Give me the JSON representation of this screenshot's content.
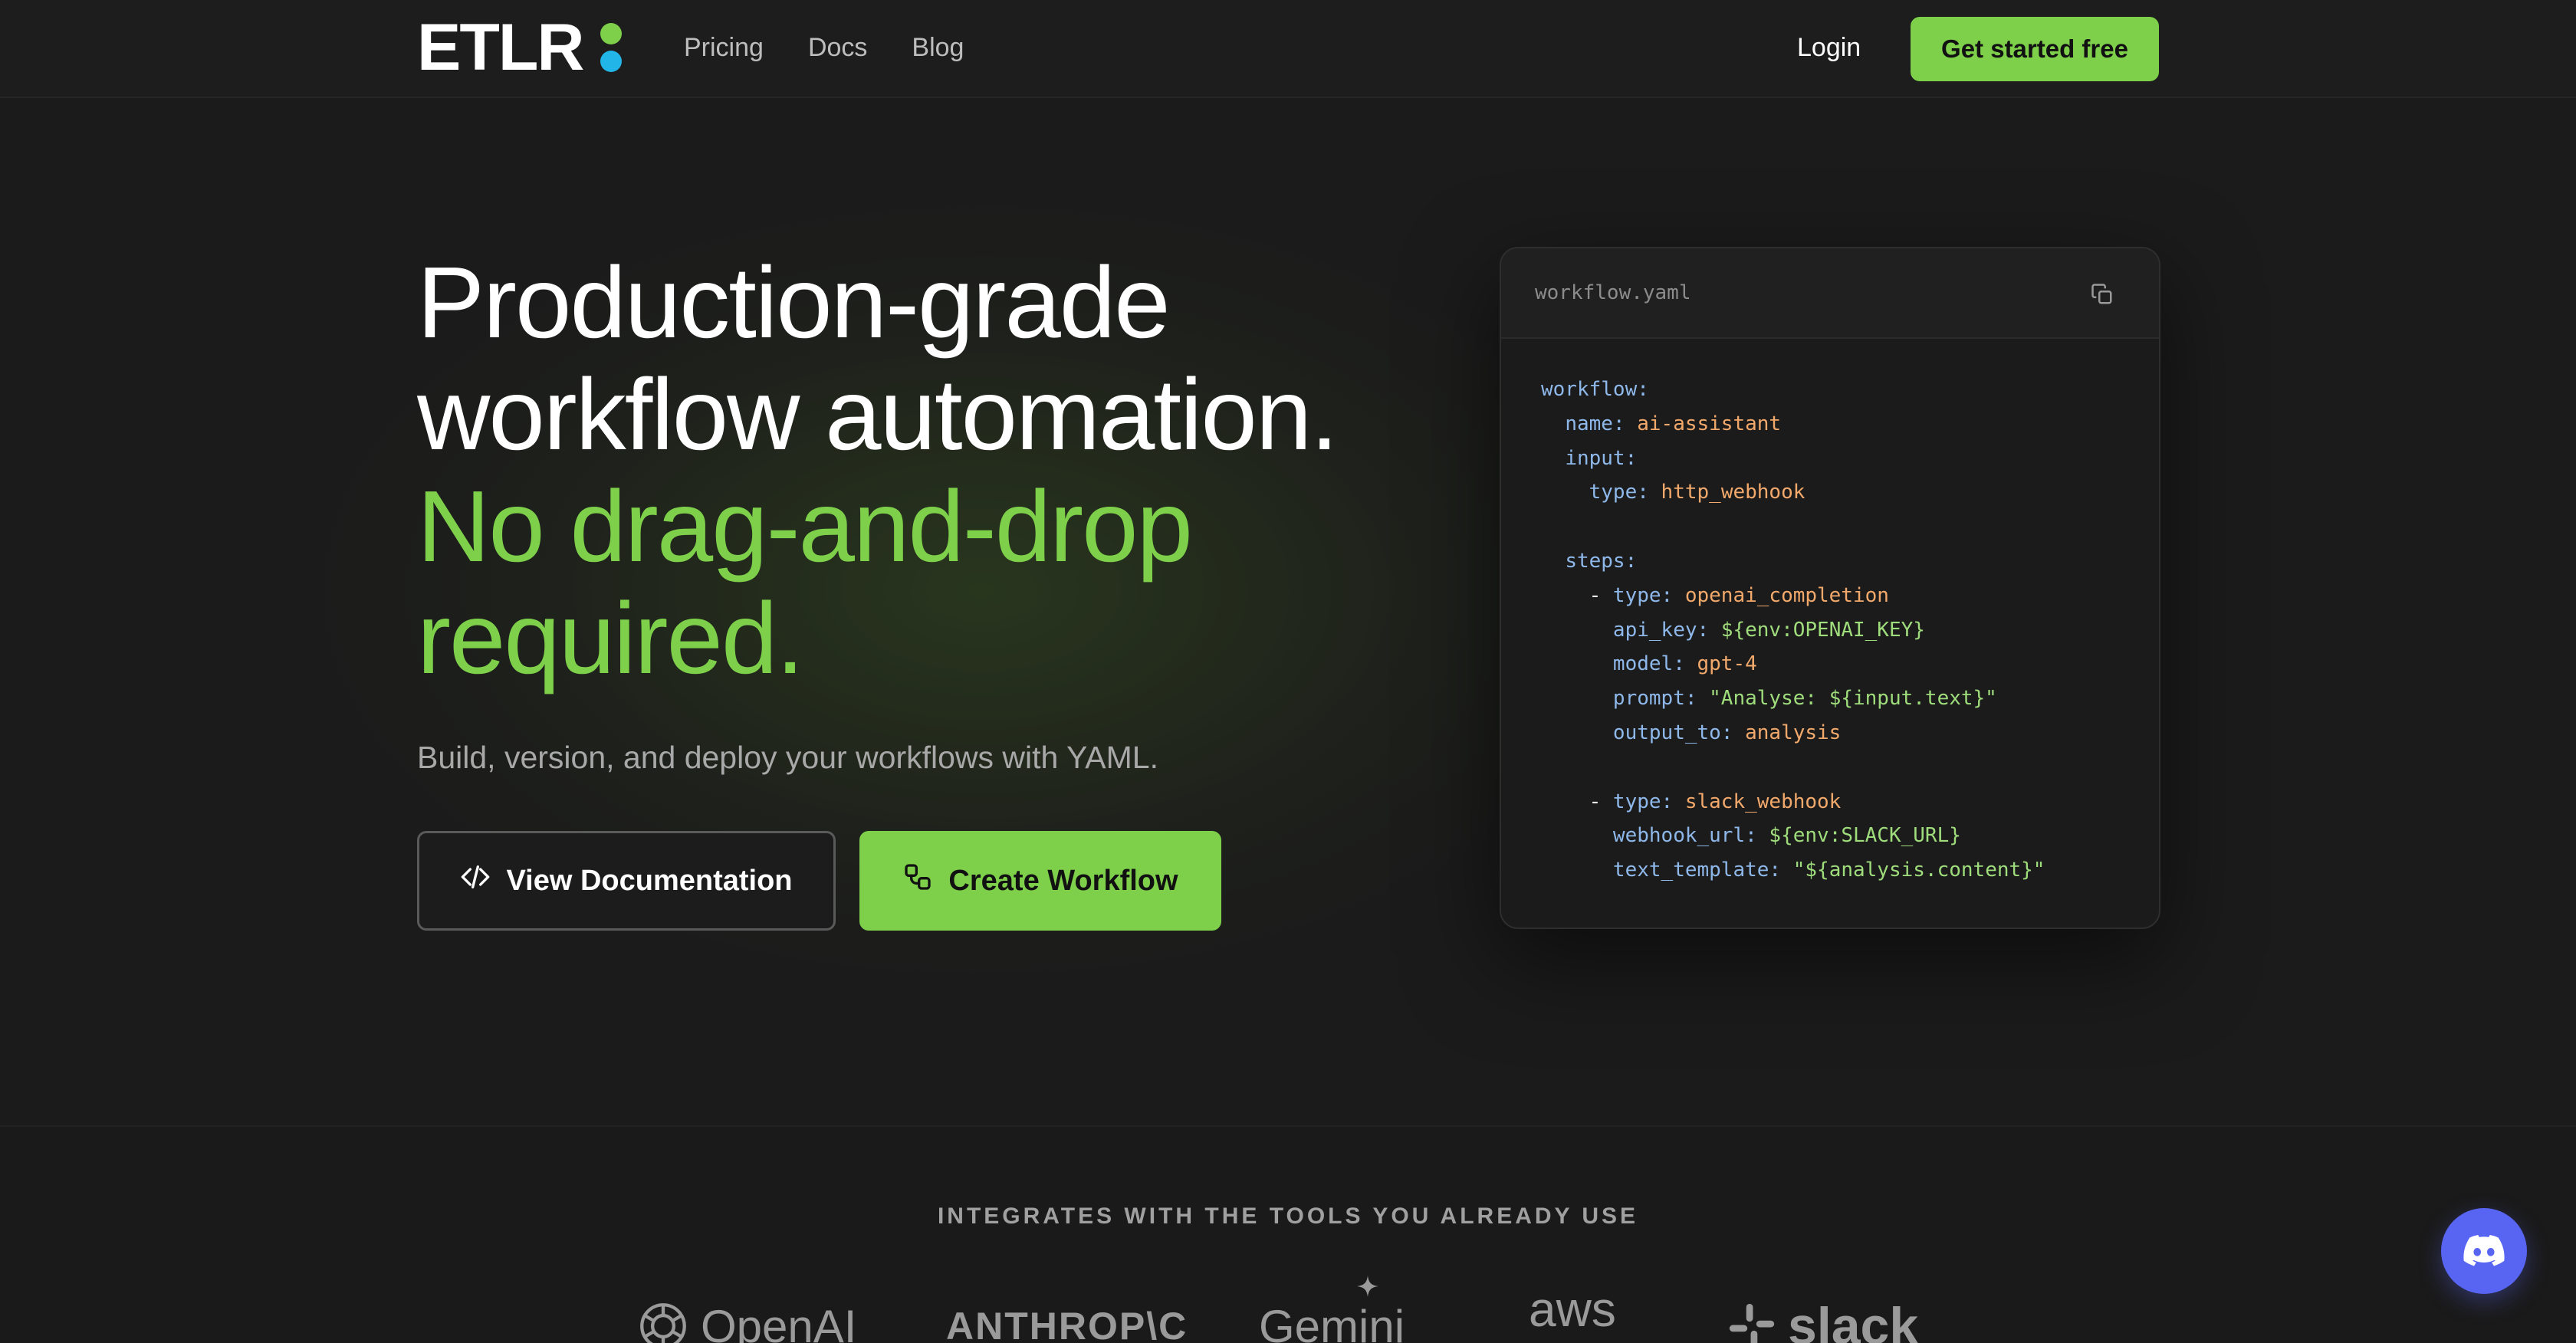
{
  "header": {
    "logo_text": "ETLR",
    "nav": [
      "Pricing",
      "Docs",
      "Blog"
    ],
    "login_label": "Login",
    "cta_label": "Get started free"
  },
  "hero": {
    "title_line1": "Production-grade",
    "title_line2": "workflow automation.",
    "title_line3": "No drag-and-drop",
    "title_line4": "required.",
    "subtitle": "Build, version, and deploy your workflows with YAML.",
    "docs_button": "View Documentation",
    "create_button": "Create Workflow"
  },
  "code": {
    "filename": "workflow.yaml",
    "lines": [
      [
        {
          "t": "k",
          "v": "workflow:"
        }
      ],
      [
        {
          "t": "p",
          "v": "  "
        },
        {
          "t": "k",
          "v": "name: "
        },
        {
          "t": "v",
          "v": "ai-assistant"
        }
      ],
      [
        {
          "t": "p",
          "v": "  "
        },
        {
          "t": "k",
          "v": "input:"
        }
      ],
      [
        {
          "t": "p",
          "v": "    "
        },
        {
          "t": "k",
          "v": "type: "
        },
        {
          "t": "v",
          "v": "http_webhook"
        }
      ],
      [],
      [
        {
          "t": "p",
          "v": "  "
        },
        {
          "t": "k",
          "v": "steps:"
        }
      ],
      [
        {
          "t": "p",
          "v": "    - "
        },
        {
          "t": "k",
          "v": "type: "
        },
        {
          "t": "v",
          "v": "openai_completion"
        }
      ],
      [
        {
          "t": "p",
          "v": "      "
        },
        {
          "t": "k",
          "v": "api_key: "
        },
        {
          "t": "s",
          "v": "${env:OPENAI_KEY}"
        }
      ],
      [
        {
          "t": "p",
          "v": "      "
        },
        {
          "t": "k",
          "v": "model: "
        },
        {
          "t": "v",
          "v": "gpt-4"
        }
      ],
      [
        {
          "t": "p",
          "v": "      "
        },
        {
          "t": "k",
          "v": "prompt: "
        },
        {
          "t": "s",
          "v": "\"Analyse: ${input.text}\""
        }
      ],
      [
        {
          "t": "p",
          "v": "      "
        },
        {
          "t": "k",
          "v": "output_to: "
        },
        {
          "t": "v",
          "v": "analysis"
        }
      ],
      [],
      [
        {
          "t": "p",
          "v": "    - "
        },
        {
          "t": "k",
          "v": "type: "
        },
        {
          "t": "v",
          "v": "slack_webhook"
        }
      ],
      [
        {
          "t": "p",
          "v": "      "
        },
        {
          "t": "k",
          "v": "webhook_url: "
        },
        {
          "t": "s",
          "v": "${env:SLACK_URL}"
        }
      ],
      [
        {
          "t": "p",
          "v": "      "
        },
        {
          "t": "k",
          "v": "text_template: "
        },
        {
          "t": "s",
          "v": "\"${analysis.content}\""
        }
      ]
    ]
  },
  "integrations": {
    "title": "INTEGRATES WITH THE TOOLS YOU ALREADY USE",
    "logos": [
      "OpenAI",
      "ANTHROP\\C",
      "Gemini",
      "aws",
      "slack"
    ]
  },
  "icons": {
    "code": "code-icon",
    "workflow": "workflow-icon",
    "copy": "copy-icon",
    "discord": "discord-icon"
  },
  "colors": {
    "accent": "#7ed04b",
    "logo_dot_blue": "#22b5e8",
    "discord": "#5865f2",
    "code_key": "#8fb8ea",
    "code_value": "#f2a96b",
    "code_string": "#9fdc7c"
  }
}
